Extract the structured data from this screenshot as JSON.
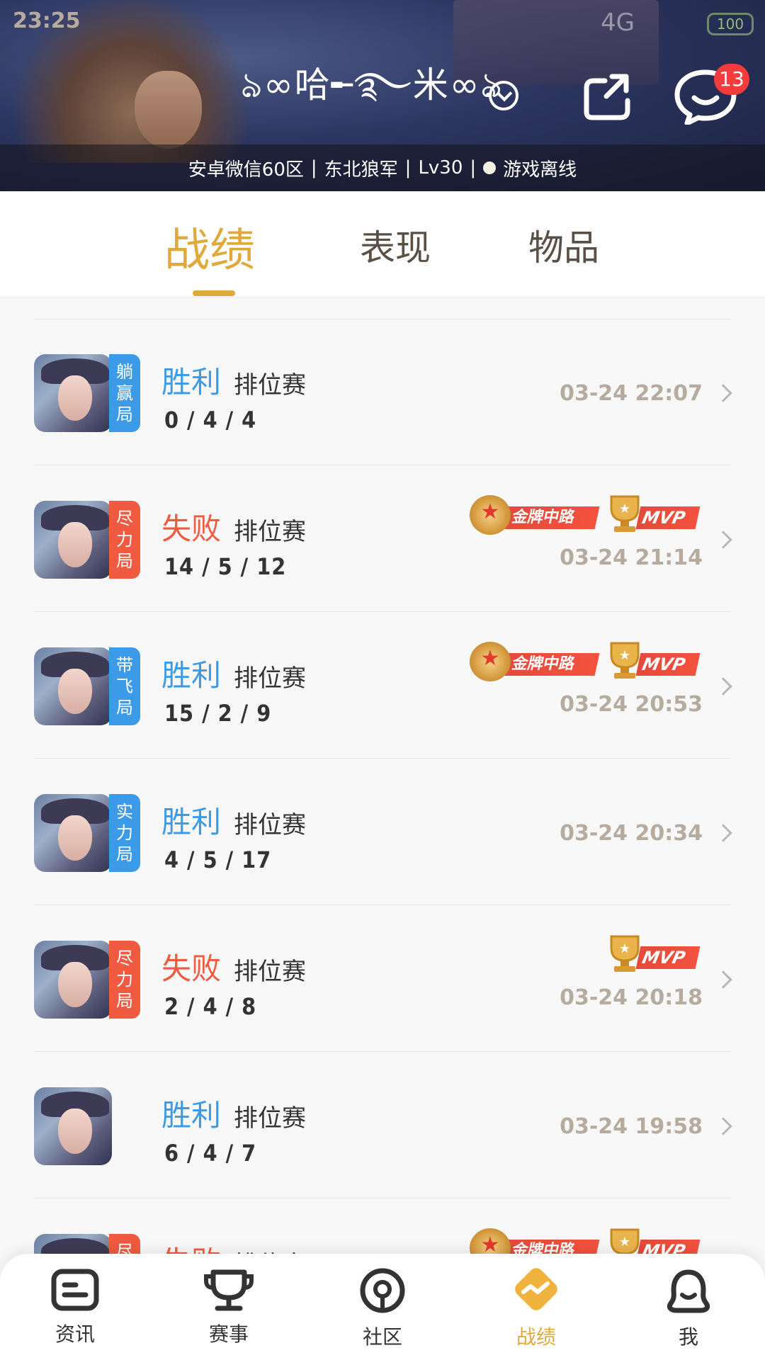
{
  "status_bar": {
    "time": "23:25",
    "network": "4G",
    "battery": "100"
  },
  "header": {
    "nickname": "ঌ∞哈╾࿐米∞ঌ",
    "message_badge": "13",
    "info": {
      "server": "安卓微信60区",
      "sep1": "|",
      "title": "东北狼军",
      "sep2": "|",
      "level": "Lv30",
      "sep3": "|",
      "status": "游戏离线"
    }
  },
  "tabs": [
    {
      "label": "战绩",
      "active": true
    },
    {
      "label": "表现",
      "active": false
    },
    {
      "label": "物品",
      "active": false
    }
  ],
  "matches": [
    {
      "tag": "躺赢局",
      "tag_color": "blue",
      "result": "胜利",
      "result_type": "win",
      "mode": "排位赛",
      "kda": "0 / 4 / 4",
      "time": "03-24 22:07",
      "gold_medal": false,
      "mvp": false
    },
    {
      "tag": "尽力局",
      "tag_color": "red",
      "result": "失败",
      "result_type": "loss",
      "mode": "排位赛",
      "kda": "14 / 5 / 12",
      "time": "03-24 21:14",
      "gold_medal": true,
      "mvp": true
    },
    {
      "tag": "带飞局",
      "tag_color": "blue",
      "result": "胜利",
      "result_type": "win",
      "mode": "排位赛",
      "kda": "15 / 2 / 9",
      "time": "03-24 20:53",
      "gold_medal": true,
      "mvp": true
    },
    {
      "tag": "实力局",
      "tag_color": "blue",
      "result": "胜利",
      "result_type": "win",
      "mode": "排位赛",
      "kda": "4 / 5 / 17",
      "time": "03-24 20:34",
      "gold_medal": false,
      "mvp": false
    },
    {
      "tag": "尽力局",
      "tag_color": "red",
      "result": "失败",
      "result_type": "loss",
      "mode": "排位赛",
      "kda": "2 / 4 / 8",
      "time": "03-24 20:18",
      "gold_medal": false,
      "mvp": true
    },
    {
      "tag": "",
      "tag_color": "",
      "result": "胜利",
      "result_type": "win",
      "mode": "排位赛",
      "kda": "6 / 4 / 7",
      "time": "03-24 19:58",
      "gold_medal": false,
      "mvp": false
    },
    {
      "tag": "尽",
      "tag_color": "red",
      "result": "失败",
      "result_type": "loss",
      "mode": "排位赛",
      "kda": "",
      "time": "",
      "gold_medal": true,
      "mvp": true
    }
  ],
  "medal_labels": {
    "gold": "金牌中路",
    "mvp": "MVP"
  },
  "bottom_nav": [
    {
      "label": "资讯",
      "icon": "news-icon",
      "active": false
    },
    {
      "label": "赛事",
      "icon": "trophy-icon",
      "active": false
    },
    {
      "label": "社区",
      "icon": "community-icon",
      "active": false
    },
    {
      "label": "战绩",
      "icon": "record-icon",
      "active": true
    },
    {
      "label": "我",
      "icon": "profile-icon",
      "active": false
    }
  ],
  "colors": {
    "accent": "#e1a83b",
    "win": "#3b9be8",
    "loss": "#f05a40",
    "badge": "#f43c3c"
  }
}
